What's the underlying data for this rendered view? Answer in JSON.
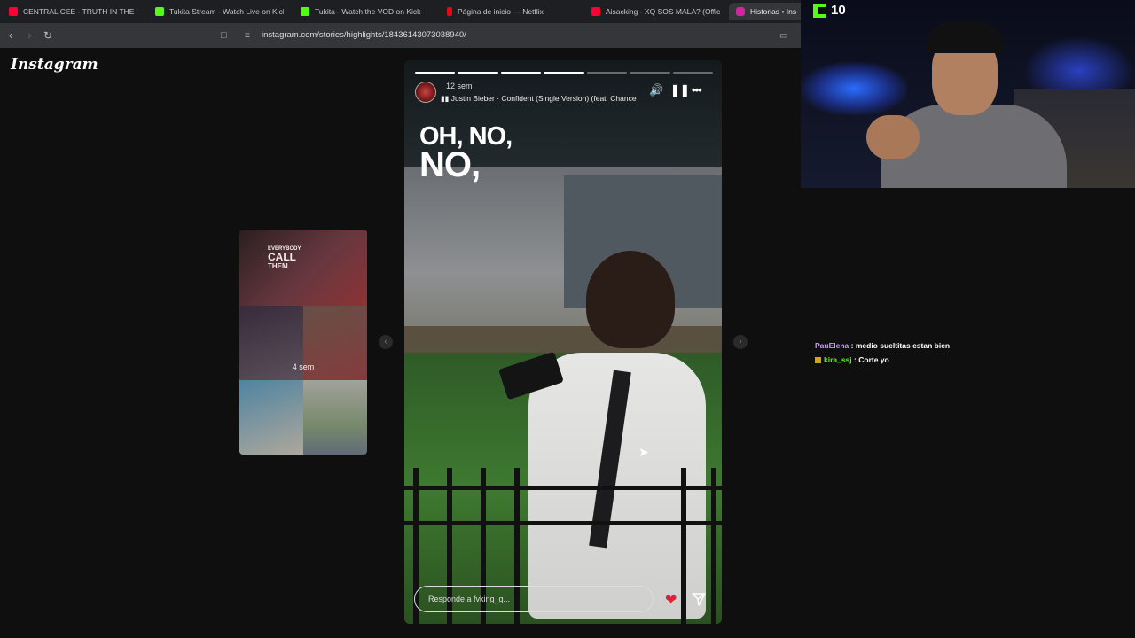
{
  "browser": {
    "tabs": [
      {
        "label": "CENTRAL CEE - TRUTH IN THE LI",
        "color": "#ff0033"
      },
      {
        "label": "Tukita Stream - Watch Live on Kick",
        "color": "#53fc18"
      },
      {
        "label": "Tukita - Watch the VOD on Kick",
        "color": "#53fc18"
      },
      {
        "label": "Página de inicio — Netflix",
        "color": "#e50914"
      },
      {
        "label": "Aisacking - XQ SOS MALA? (Official",
        "color": "#ff0033"
      },
      {
        "label": "Historias • Ins",
        "color": "#d6249f"
      }
    ],
    "url": "instagram.com/stories/highlights/18436143073038940/"
  },
  "instagram": {
    "logo": "Instagram",
    "preview": {
      "text_line1": "EVERYBODY",
      "text_line2": "CALL",
      "text_line3": "THEM",
      "time": "4 sem"
    },
    "story": {
      "time": "12 sem",
      "music": "Justin Bieber · Confident (Single Version) (feat. Chance",
      "overlay_line1": "OH, NO,",
      "overlay_line2": "NO,",
      "progress_done": 4,
      "progress_total": 7,
      "reply_placeholder": "Responde a fvking_g..."
    }
  },
  "stream": {
    "viewer_count": "10",
    "chat": [
      {
        "user": "PauElena",
        "message": "medio sueltitas estan bien"
      },
      {
        "user": "kira_ssj",
        "message": "Corte yo"
      }
    ]
  }
}
